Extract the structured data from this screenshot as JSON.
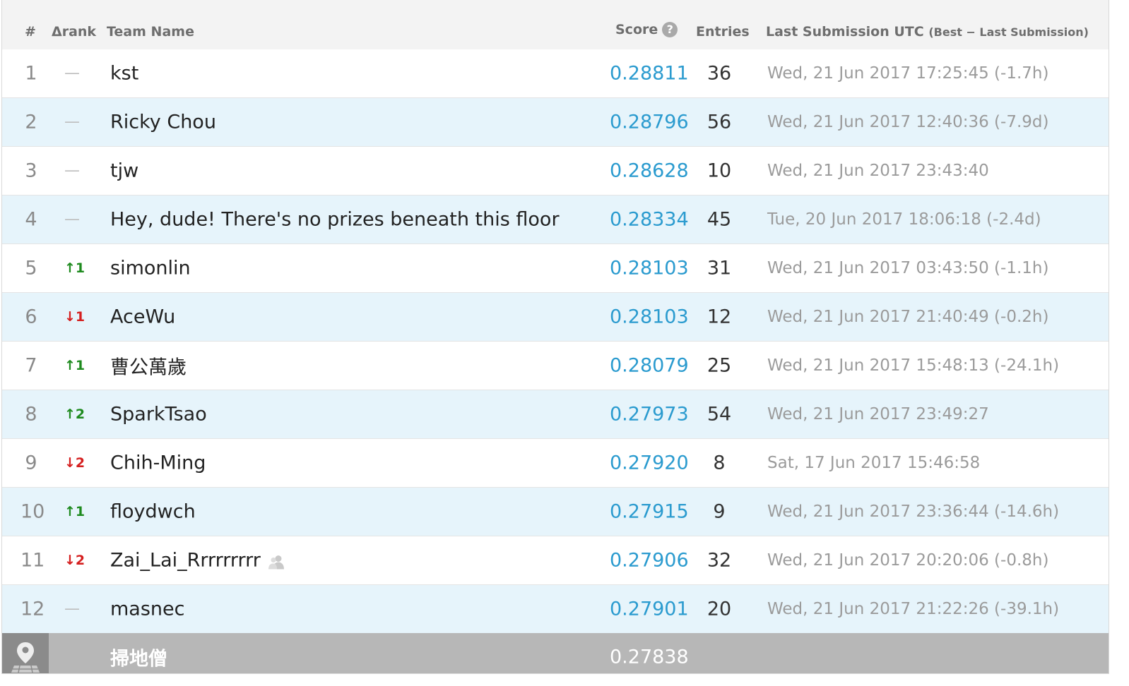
{
  "header": {
    "rank": "#",
    "delta": "Δrank",
    "team": "Team Name",
    "score": "Score",
    "score_help_icon": "question-icon",
    "entries": "Entries",
    "last": "Last Submission UTC",
    "last_sub": "(Best − Last Submission)"
  },
  "rows": [
    {
      "rank": "1",
      "delta": "—",
      "delta_dir": "same",
      "team": "kst",
      "score": "0.28811",
      "entries": "36",
      "last": "Wed, 21 Jun 2017 17:25:45 (-1.7h)"
    },
    {
      "rank": "2",
      "delta": "—",
      "delta_dir": "same",
      "team": "Ricky Chou",
      "score": "0.28796",
      "entries": "56",
      "last": "Wed, 21 Jun 2017 12:40:36 (-7.9d)"
    },
    {
      "rank": "3",
      "delta": "—",
      "delta_dir": "same",
      "team": "tjw",
      "score": "0.28628",
      "entries": "10",
      "last": "Wed, 21 Jun 2017 23:43:40"
    },
    {
      "rank": "4",
      "delta": "—",
      "delta_dir": "same",
      "team": "Hey, dude! There's no prizes beneath this floor",
      "score": "0.28334",
      "entries": "45",
      "last": "Tue, 20 Jun 2017 18:06:18 (-2.4d)"
    },
    {
      "rank": "5",
      "delta": "↑1",
      "delta_dir": "up",
      "team": "simonlin",
      "score": "0.28103",
      "entries": "31",
      "last": "Wed, 21 Jun 2017 03:43:50 (-1.1h)"
    },
    {
      "rank": "6",
      "delta": "↓1",
      "delta_dir": "down",
      "team": "AceWu",
      "score": "0.28103",
      "entries": "12",
      "last": "Wed, 21 Jun 2017 21:40:49 (-0.2h)"
    },
    {
      "rank": "7",
      "delta": "↑1",
      "delta_dir": "up",
      "team": "曹公萬歲",
      "score": "0.28079",
      "entries": "25",
      "last": "Wed, 21 Jun 2017 15:48:13 (-24.1h)"
    },
    {
      "rank": "8",
      "delta": "↑2",
      "delta_dir": "up",
      "team": "SparkTsao",
      "score": "0.27973",
      "entries": "54",
      "last": "Wed, 21 Jun 2017 23:49:27"
    },
    {
      "rank": "9",
      "delta": "↓2",
      "delta_dir": "down",
      "team": "Chih-Ming",
      "score": "0.27920",
      "entries": "8",
      "last": "Sat, 17 Jun 2017 15:46:58"
    },
    {
      "rank": "10",
      "delta": "↑1",
      "delta_dir": "up",
      "team": "floydwch",
      "score": "0.27915",
      "entries": "9",
      "last": "Wed, 21 Jun 2017 23:36:44 (-14.6h)"
    },
    {
      "rank": "11",
      "delta": "↓2",
      "delta_dir": "down",
      "team": "Zai_Lai_Rrrrrrrrr",
      "team_icon": "team-members-icon",
      "score": "0.27906",
      "entries": "32",
      "last": "Wed, 21 Jun 2017 20:20:06 (-0.8h)"
    },
    {
      "rank": "12",
      "delta": "—",
      "delta_dir": "same",
      "team": "masnec",
      "score": "0.27901",
      "entries": "20",
      "last": "Wed, 21 Jun 2017 21:22:26 (-39.1h)"
    }
  ],
  "benchmark": {
    "icon": "map-pin-icon",
    "team": "掃地僧",
    "score": "0.27838"
  },
  "colors": {
    "score": "#2b9bcf",
    "up": "#1e8a1e",
    "down": "#d51f1f",
    "row_alt": "#e6f4fb",
    "benchmark_bg": "#b7b7b7"
  }
}
